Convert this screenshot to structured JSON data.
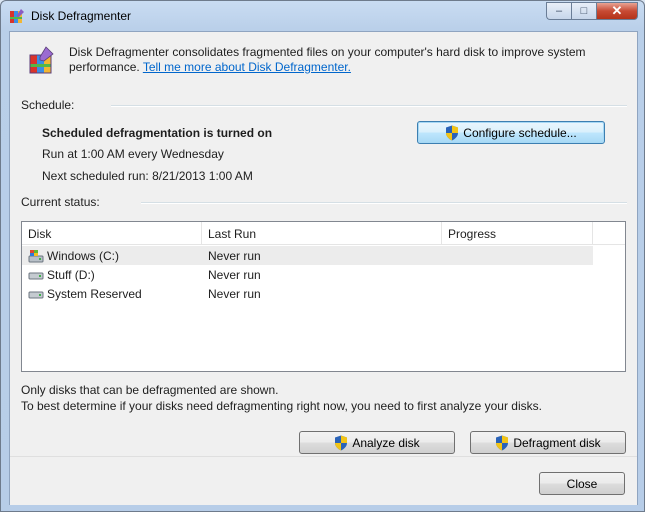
{
  "window": {
    "title": "Disk Defragmenter"
  },
  "intro": {
    "text": "Disk Defragmenter consolidates fragmented files on your computer's hard disk to improve system performance.",
    "link": "Tell me more about Disk Defragmenter."
  },
  "schedule": {
    "label": "Schedule:",
    "status": "Scheduled defragmentation is turned on",
    "run_at": "Run at 1:00 AM every Wednesday",
    "next_run": "Next scheduled run: 8/21/2013 1:00 AM",
    "configure_button": "Configure schedule..."
  },
  "current_status": {
    "label": "Current status:",
    "columns": [
      "Disk",
      "Last Run",
      "Progress"
    ],
    "rows": [
      {
        "disk": "Windows (C:)",
        "last_run": "Never run",
        "progress": "",
        "icon": "windows-drive-icon",
        "selected": true
      },
      {
        "disk": "Stuff (D:)",
        "last_run": "Never run",
        "progress": "",
        "icon": "hard-drive-icon",
        "selected": false
      },
      {
        "disk": "System Reserved",
        "last_run": "Never run",
        "progress": "",
        "icon": "hard-drive-icon",
        "selected": false
      }
    ]
  },
  "notes": {
    "line1": "Only disks that can be defragmented are shown.",
    "line2": "To best determine if your disks need defragmenting right now, you need to first analyze your disks."
  },
  "buttons": {
    "analyze": "Analyze disk",
    "defragment": "Defragment disk",
    "close": "Close"
  },
  "colors": {
    "link": "#0066cc",
    "selection": "#ececec"
  }
}
